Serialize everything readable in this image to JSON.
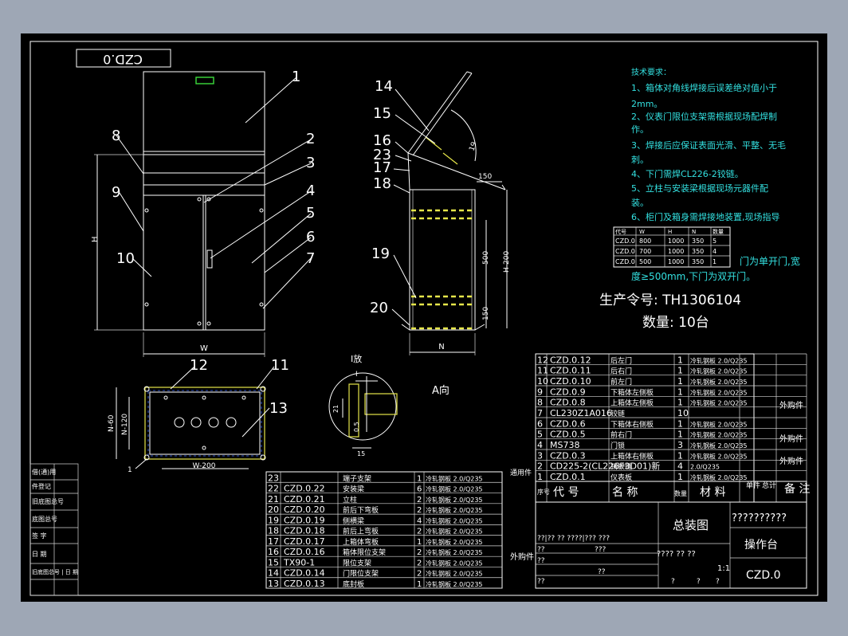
{
  "drawing_code_box": "CZD.0",
  "part_numbers": {
    "p1": "1",
    "p2": "2",
    "p3": "3",
    "p4": "4",
    "p5": "5",
    "p6": "6",
    "p7": "7",
    "p8": "8",
    "p9": "9",
    "p10": "10",
    "p11": "11",
    "p12": "12",
    "p13": "13",
    "p14": "14",
    "p15": "15",
    "p16": "16",
    "p17": "17",
    "p18": "18",
    "p19": "19",
    "p20": "20",
    "p23": "23"
  },
  "dimensions": {
    "h": "H",
    "w": "W",
    "n": "N",
    "h200": "H-200",
    "d500": "500",
    "d150a": "150",
    "d150b": "150",
    "d150c": "150",
    "w200": "W-200",
    "n60": "N-60",
    "n120": "N-120",
    "a19": "19",
    "d21": "21",
    "d05": "0.5",
    "d15": "15",
    "one": "1"
  },
  "view_labels": {
    "detail_one": "I放",
    "view_a": "A向",
    "arrow_a": "A",
    "arrow_i": "I"
  },
  "tech": {
    "title": "技术要求：",
    "r1": "1、箱体对角线焊接后误差绝对值小于",
    "r1b": "2mm。",
    "r2": "2、仪表门限位支架需根据现场配焊制",
    "r2b": "作。",
    "r3": "3、焊接后应保证表面光滑、平整、无毛",
    "r3b": "刺。",
    "r4": "4、下门需焊CL226-2铰链。",
    "r5": "5、立柱与安装梁根据现场元器件配",
    "r5b": "装。",
    "r6": "6、柜门及箱身需焊接地装置,现场指导",
    "r6c": "门为单开门,宽",
    "r6d": "度≥500mm,下门为双开门。"
  },
  "size_table": {
    "header": [
      "代号",
      "W",
      "H",
      "N",
      "数量"
    ],
    "rows": [
      [
        "CZD.0",
        "800",
        "1000",
        "350",
        "5"
      ],
      [
        "CZD.0",
        "700",
        "1000",
        "350",
        "4"
      ],
      [
        "CZD.0",
        "500",
        "1000",
        "350",
        "1"
      ]
    ]
  },
  "order_no": "生产令号: TH1306104",
  "quantity": "数量: 10台",
  "bom_right": {
    "rows": [
      [
        "12",
        "CZD.0.12",
        "后左门",
        "1",
        "冷轧钢板 2.0/Q235"
      ],
      [
        "11",
        "CZD.0.11",
        "后右门",
        "1",
        "冷轧钢板 2.0/Q235"
      ],
      [
        "10",
        "CZD.0.10",
        "前左门",
        "1",
        "冷轧钢板 2.0/Q235"
      ],
      [
        "9",
        "CZD.0.9",
        "下箱体左侧板",
        "1",
        "冷轧钢板 2.0/Q235"
      ],
      [
        "8",
        "CZD.0.8",
        "上箱体左侧板",
        "1",
        "冷轧钢板 2.0/Q235"
      ],
      [
        "7",
        "CL230Z1A016",
        "铰链",
        "10",
        ""
      ],
      [
        "6",
        "CZD.0.6",
        "下箱体右侧板",
        "1",
        "冷轧钢板 2.0/Q235"
      ],
      [
        "5",
        "CZD.0.5",
        "前右门",
        "1",
        "冷轧钢板 2.0/Q235"
      ],
      [
        "4",
        "MS738",
        "门锁",
        "3",
        "冷轧钢板 2.0/Q235"
      ],
      [
        "3",
        "CZD.0.3",
        "上箱体右侧板",
        "1",
        "冷轧钢板 2.0/Q235"
      ],
      [
        "2",
        "CD225-2(CL226F3D01)新",
        "销铰链",
        "4",
        "2.0/Q235"
      ],
      [
        "1",
        "CZD.0.1",
        "仪表板",
        "1",
        "冷轧钢板 2.0/Q235"
      ]
    ],
    "buy": "外购件",
    "common": "通用件",
    "header": [
      "序号",
      "代 号",
      "名 称",
      "数量",
      "材 料",
      "单件",
      "总计",
      "备 注"
    ]
  },
  "bom_left": {
    "rows": [
      [
        "23",
        "",
        "端子支架",
        "1",
        "冷轧钢板 2.0/Q235"
      ],
      [
        "22",
        "CZD.0.22",
        "安装梁",
        "6",
        "冷轧钢板 2.0/Q235"
      ],
      [
        "21",
        "CZD.0.21",
        "立柱",
        "2",
        "冷轧钢板 2.0/Q235"
      ],
      [
        "20",
        "CZD.0.20",
        "前后下弯板",
        "2",
        "冷轧钢板 2.0/Q235"
      ],
      [
        "19",
        "CZD.0.19",
        "侧横梁",
        "4",
        "冷轧钢板 2.0/Q235"
      ],
      [
        "18",
        "CZD.0.18",
        "前后上弯板",
        "2",
        "冷轧钢板 2.0/Q235"
      ],
      [
        "17",
        "CZD.0.17",
        "上箱体弯板",
        "1",
        "冷轧钢板 2.0/Q235"
      ],
      [
        "16",
        "CZD.0.16",
        "箱体限位支架",
        "2",
        "冷轧钢板 2.0/Q235"
      ],
      [
        "15",
        "TX90-1",
        "限位支架",
        "2",
        "冷轧钢板 2.0/Q235"
      ],
      [
        "14",
        "CZD.0.14",
        "门限位支架",
        "2",
        "冷轧钢板 2.0/Q235"
      ],
      [
        "13",
        "CZD.0.13",
        "底封板",
        "1",
        "冷轧钢板 2.0/Q235"
      ]
    ],
    "buy": "外购件"
  },
  "title_block": {
    "name": "总装图",
    "product": "操作台",
    "code": "CZD.0",
    "scale": "1:1",
    "garbled": "??????????",
    "sub": "????  ??  ??",
    "q": "?",
    "g1": "??|??  ??  ????|???  ???",
    "g2": "??",
    "g3": "???"
  },
  "left_strip": [
    "借(通)用",
    "件登记",
    "旧底图总号",
    "底图总号",
    "签 字",
    "日 期"
  ],
  "left_strip_b": "旧底图总号 | 日 期"
}
